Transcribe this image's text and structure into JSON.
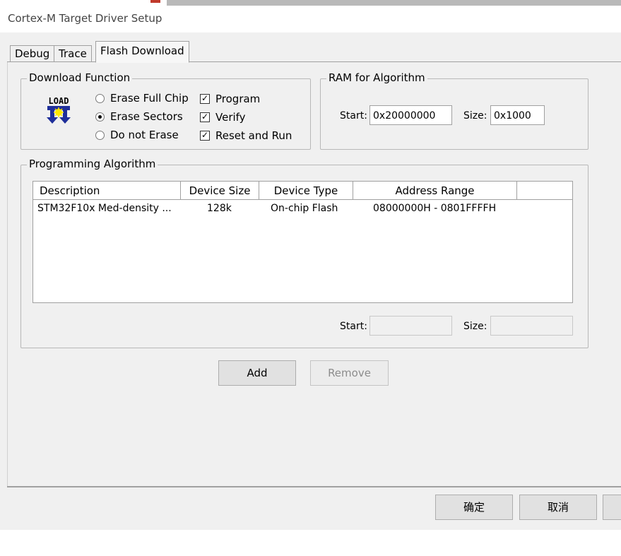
{
  "window": {
    "title": "Cortex-M Target Driver Setup"
  },
  "tabs": [
    {
      "label": "Debug"
    },
    {
      "label": "Trace"
    },
    {
      "label": "Flash Download"
    }
  ],
  "download_function": {
    "group_title": "Download Function",
    "icon_text": "LOAD",
    "erase_options": [
      {
        "label": "Erase Full Chip",
        "selected": false
      },
      {
        "label": "Erase Sectors",
        "selected": true
      },
      {
        "label": "Do not Erase",
        "selected": false
      }
    ],
    "checks": [
      {
        "label": "Program",
        "checked": true
      },
      {
        "label": "Verify",
        "checked": true
      },
      {
        "label": "Reset and Run",
        "checked": true
      }
    ]
  },
  "ram": {
    "group_title": "RAM for Algorithm",
    "start_label": "Start:",
    "start_value": "0x20000000",
    "size_label": "Size:",
    "size_value": "0x1000"
  },
  "programming_algorithm": {
    "group_title": "Programming Algorithm",
    "columns": [
      "Description",
      "Device Size",
      "Device Type",
      "Address Range"
    ],
    "rows": [
      {
        "description": "STM32F10x Med-density ...",
        "device_size": "128k",
        "device_type": "On-chip Flash",
        "address_range": "08000000H - 0801FFFFH"
      }
    ],
    "start_label": "Start:",
    "start_value": "",
    "size_label": "Size:",
    "size_value": ""
  },
  "buttons": {
    "add": "Add",
    "remove": "Remove"
  },
  "footer": {
    "ok": "确定",
    "cancel": "取消"
  }
}
